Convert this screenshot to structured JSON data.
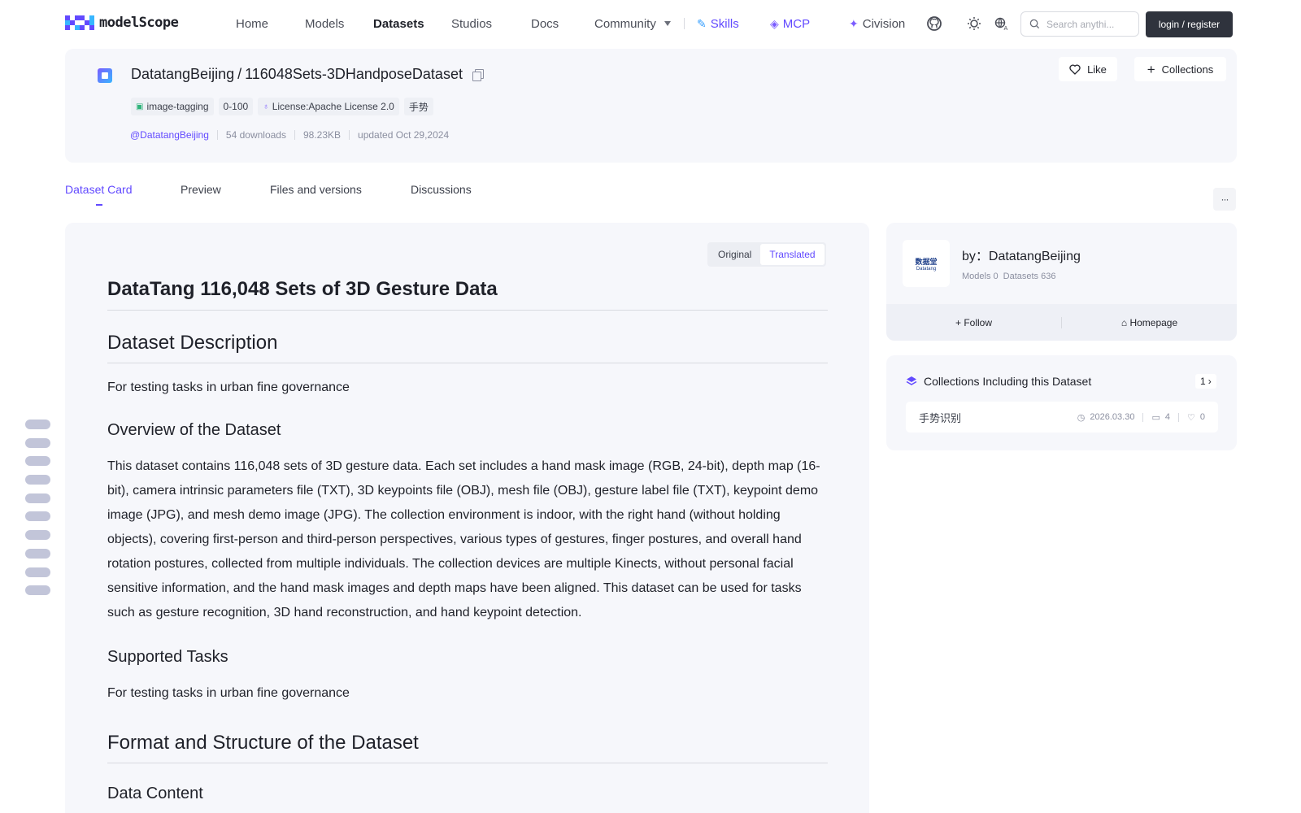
{
  "nav": {
    "logo_text": "modelScope",
    "items": [
      {
        "label": "Home"
      },
      {
        "label": "Models"
      },
      {
        "label": "Datasets"
      },
      {
        "label": "Studios"
      },
      {
        "label": "Docs"
      },
      {
        "label": "Community"
      }
    ],
    "skills_label": "Skills",
    "mcp_label": "MCP",
    "civision_label": "Civision",
    "search_placeholder": "Search anythi...",
    "login_label": "login / register"
  },
  "dataset": {
    "owner": "DatatangBeijing",
    "name": "116048Sets-3DHandposeDataset",
    "separator": "/",
    "like_label": "Like",
    "collections_label": "Collections",
    "tags": [
      {
        "label": "image-tagging",
        "icon": "image-tag-icon"
      },
      {
        "label": "0-100",
        "icon": ""
      },
      {
        "label": "License:Apache License 2.0",
        "icon": "license-icon"
      },
      {
        "label": "手势",
        "icon": ""
      }
    ],
    "author": "@DatatangBeijing",
    "downloads": "54 downloads",
    "size": "98.23KB",
    "updated": "updated Oct 29,2024"
  },
  "tabs": [
    {
      "label": "Dataset Card"
    },
    {
      "label": "Preview"
    },
    {
      "label": "Files and versions"
    },
    {
      "label": "Discussions"
    }
  ],
  "more_label": "···",
  "lang_toggle": {
    "original": "Original",
    "translated": "Translated"
  },
  "doc": {
    "h1": "DataTang 116,048 Sets of 3D Gesture Data",
    "sec1": "Dataset Description",
    "p1": "For testing tasks in urban fine governance",
    "sec1a": "Overview of the Dataset",
    "p2": "This dataset contains 116,048 sets of 3D gesture data. Each set includes a hand mask image (RGB, 24-bit), depth map (16-bit), camera intrinsic parameters file (TXT), 3D keypoints file (OBJ), mesh file (OBJ), gesture label file (TXT), keypoint demo image (JPG), and mesh demo image (JPG). The collection environment is indoor, with the right hand (without holding objects), covering first-person and third-person perspectives, various types of gestures, finger postures, and overall hand rotation postures, collected from multiple individuals. The collection devices are multiple Kinects, without personal facial sensitive information, and the hand mask images and depth maps have been aligned. This dataset can be used for tasks such as gesture recognition, 3D hand reconstruction, and hand keypoint detection.",
    "sec1b": "Supported Tasks",
    "p3": "For testing tasks in urban fine governance",
    "sec2": "Format and Structure of the Dataset",
    "sec2a": "Data Content"
  },
  "org": {
    "name": "by：DatatangBeijing",
    "logo_text": "数据堂",
    "logo_sub": "Datatang",
    "models": "Models 0",
    "datasets": "Datasets 636",
    "follow_label": "Follow",
    "homepage_label": "Homepage"
  },
  "collections": {
    "title": "Collections Including this Dataset",
    "count": "1",
    "items": [
      {
        "name": "手势识别",
        "date": "2026.03.30",
        "count": "4",
        "likes": "0"
      }
    ]
  },
  "colors": {
    "accent": "#624aff",
    "card_bg": "#f6f7fb",
    "login_bg": "#2f333d"
  }
}
